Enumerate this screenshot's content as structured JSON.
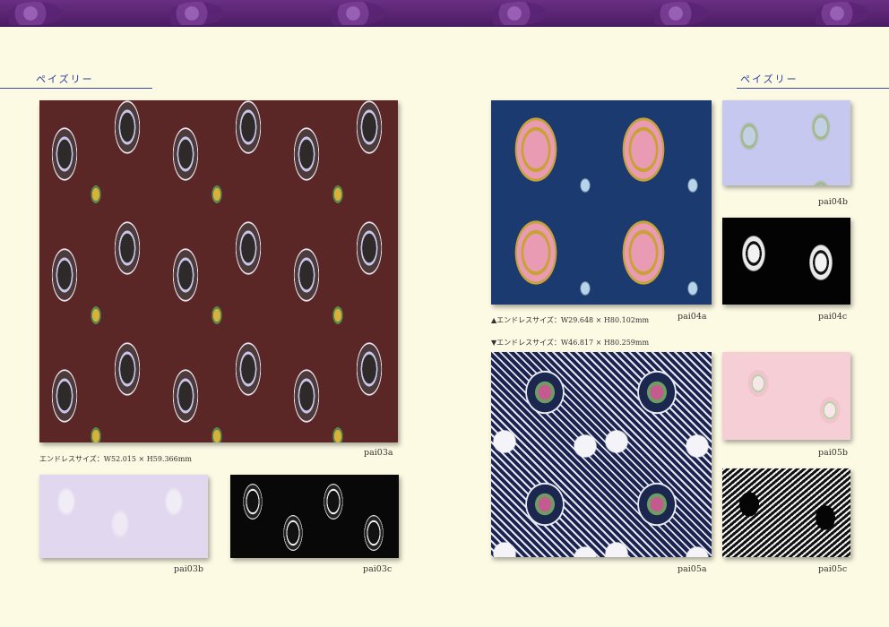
{
  "left_page": {
    "section_title": "ペイズリー",
    "main": {
      "code": "pai03a",
      "size": "エンドレスサイズ：W52.015 × H59.366mm"
    },
    "thumbs": [
      {
        "code": "pai03b"
      },
      {
        "code": "pai03c"
      }
    ]
  },
  "right_page": {
    "section_title": "ペイズリー",
    "items": [
      {
        "code": "pai04a",
        "size": "▲エンドレスサイズ：W29.648 × H80.102mm"
      },
      {
        "code": "pai04b"
      },
      {
        "code": "pai04c"
      },
      {
        "code": "pai05a",
        "size": "▼エンドレスサイズ：W46.817 × H80.259mm"
      },
      {
        "code": "pai05b"
      },
      {
        "code": "pai05c"
      }
    ]
  },
  "colors": {
    "background": "#fcfae3",
    "header_band": "#5a2474",
    "title": "#2c3f9a"
  }
}
